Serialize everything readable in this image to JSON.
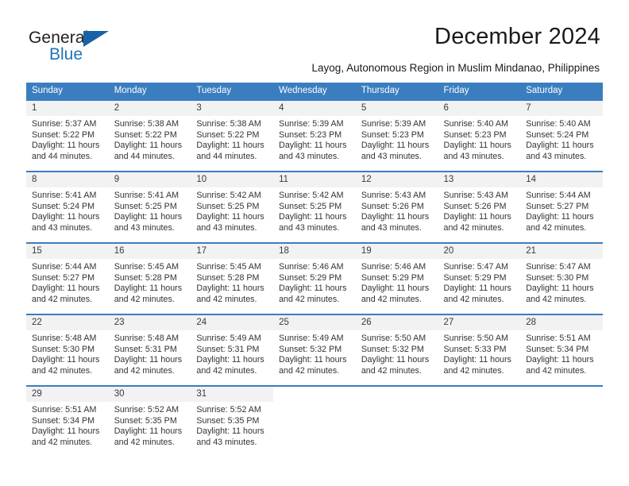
{
  "brand": {
    "name_top": "General",
    "name_bottom": "Blue",
    "accent_color": "#1763a5",
    "text_color": "#231f20"
  },
  "header": {
    "title": "December 2024",
    "subtitle": "Layog, Autonomous Region in Muslim Mindanao, Philippines"
  },
  "calendar": {
    "header_bg": "#3a7ebf",
    "header_text_color": "#ffffff",
    "daynum_bg": "#f2f2f2",
    "weekday_labels": [
      "Sunday",
      "Monday",
      "Tuesday",
      "Wednesday",
      "Thursday",
      "Friday",
      "Saturday"
    ],
    "labels": {
      "sunrise": "Sunrise:",
      "sunset": "Sunset:",
      "daylight": "Daylight:"
    },
    "weeks": [
      [
        {
          "day": "1",
          "sunrise": "Sunrise: 5:37 AM",
          "sunset": "Sunset: 5:22 PM",
          "daylight_line1": "Daylight: 11 hours",
          "daylight_line2": "and 44 minutes."
        },
        {
          "day": "2",
          "sunrise": "Sunrise: 5:38 AM",
          "sunset": "Sunset: 5:22 PM",
          "daylight_line1": "Daylight: 11 hours",
          "daylight_line2": "and 44 minutes."
        },
        {
          "day": "3",
          "sunrise": "Sunrise: 5:38 AM",
          "sunset": "Sunset: 5:22 PM",
          "daylight_line1": "Daylight: 11 hours",
          "daylight_line2": "and 44 minutes."
        },
        {
          "day": "4",
          "sunrise": "Sunrise: 5:39 AM",
          "sunset": "Sunset: 5:23 PM",
          "daylight_line1": "Daylight: 11 hours",
          "daylight_line2": "and 43 minutes."
        },
        {
          "day": "5",
          "sunrise": "Sunrise: 5:39 AM",
          "sunset": "Sunset: 5:23 PM",
          "daylight_line1": "Daylight: 11 hours",
          "daylight_line2": "and 43 minutes."
        },
        {
          "day": "6",
          "sunrise": "Sunrise: 5:40 AM",
          "sunset": "Sunset: 5:23 PM",
          "daylight_line1": "Daylight: 11 hours",
          "daylight_line2": "and 43 minutes."
        },
        {
          "day": "7",
          "sunrise": "Sunrise: 5:40 AM",
          "sunset": "Sunset: 5:24 PM",
          "daylight_line1": "Daylight: 11 hours",
          "daylight_line2": "and 43 minutes."
        }
      ],
      [
        {
          "day": "8",
          "sunrise": "Sunrise: 5:41 AM",
          "sunset": "Sunset: 5:24 PM",
          "daylight_line1": "Daylight: 11 hours",
          "daylight_line2": "and 43 minutes."
        },
        {
          "day": "9",
          "sunrise": "Sunrise: 5:41 AM",
          "sunset": "Sunset: 5:25 PM",
          "daylight_line1": "Daylight: 11 hours",
          "daylight_line2": "and 43 minutes."
        },
        {
          "day": "10",
          "sunrise": "Sunrise: 5:42 AM",
          "sunset": "Sunset: 5:25 PM",
          "daylight_line1": "Daylight: 11 hours",
          "daylight_line2": "and 43 minutes."
        },
        {
          "day": "11",
          "sunrise": "Sunrise: 5:42 AM",
          "sunset": "Sunset: 5:25 PM",
          "daylight_line1": "Daylight: 11 hours",
          "daylight_line2": "and 43 minutes."
        },
        {
          "day": "12",
          "sunrise": "Sunrise: 5:43 AM",
          "sunset": "Sunset: 5:26 PM",
          "daylight_line1": "Daylight: 11 hours",
          "daylight_line2": "and 43 minutes."
        },
        {
          "day": "13",
          "sunrise": "Sunrise: 5:43 AM",
          "sunset": "Sunset: 5:26 PM",
          "daylight_line1": "Daylight: 11 hours",
          "daylight_line2": "and 42 minutes."
        },
        {
          "day": "14",
          "sunrise": "Sunrise: 5:44 AM",
          "sunset": "Sunset: 5:27 PM",
          "daylight_line1": "Daylight: 11 hours",
          "daylight_line2": "and 42 minutes."
        }
      ],
      [
        {
          "day": "15",
          "sunrise": "Sunrise: 5:44 AM",
          "sunset": "Sunset: 5:27 PM",
          "daylight_line1": "Daylight: 11 hours",
          "daylight_line2": "and 42 minutes."
        },
        {
          "day": "16",
          "sunrise": "Sunrise: 5:45 AM",
          "sunset": "Sunset: 5:28 PM",
          "daylight_line1": "Daylight: 11 hours",
          "daylight_line2": "and 42 minutes."
        },
        {
          "day": "17",
          "sunrise": "Sunrise: 5:45 AM",
          "sunset": "Sunset: 5:28 PM",
          "daylight_line1": "Daylight: 11 hours",
          "daylight_line2": "and 42 minutes."
        },
        {
          "day": "18",
          "sunrise": "Sunrise: 5:46 AM",
          "sunset": "Sunset: 5:29 PM",
          "daylight_line1": "Daylight: 11 hours",
          "daylight_line2": "and 42 minutes."
        },
        {
          "day": "19",
          "sunrise": "Sunrise: 5:46 AM",
          "sunset": "Sunset: 5:29 PM",
          "daylight_line1": "Daylight: 11 hours",
          "daylight_line2": "and 42 minutes."
        },
        {
          "day": "20",
          "sunrise": "Sunrise: 5:47 AM",
          "sunset": "Sunset: 5:29 PM",
          "daylight_line1": "Daylight: 11 hours",
          "daylight_line2": "and 42 minutes."
        },
        {
          "day": "21",
          "sunrise": "Sunrise: 5:47 AM",
          "sunset": "Sunset: 5:30 PM",
          "daylight_line1": "Daylight: 11 hours",
          "daylight_line2": "and 42 minutes."
        }
      ],
      [
        {
          "day": "22",
          "sunrise": "Sunrise: 5:48 AM",
          "sunset": "Sunset: 5:30 PM",
          "daylight_line1": "Daylight: 11 hours",
          "daylight_line2": "and 42 minutes."
        },
        {
          "day": "23",
          "sunrise": "Sunrise: 5:48 AM",
          "sunset": "Sunset: 5:31 PM",
          "daylight_line1": "Daylight: 11 hours",
          "daylight_line2": "and 42 minutes."
        },
        {
          "day": "24",
          "sunrise": "Sunrise: 5:49 AM",
          "sunset": "Sunset: 5:31 PM",
          "daylight_line1": "Daylight: 11 hours",
          "daylight_line2": "and 42 minutes."
        },
        {
          "day": "25",
          "sunrise": "Sunrise: 5:49 AM",
          "sunset": "Sunset: 5:32 PM",
          "daylight_line1": "Daylight: 11 hours",
          "daylight_line2": "and 42 minutes."
        },
        {
          "day": "26",
          "sunrise": "Sunrise: 5:50 AM",
          "sunset": "Sunset: 5:32 PM",
          "daylight_line1": "Daylight: 11 hours",
          "daylight_line2": "and 42 minutes."
        },
        {
          "day": "27",
          "sunrise": "Sunrise: 5:50 AM",
          "sunset": "Sunset: 5:33 PM",
          "daylight_line1": "Daylight: 11 hours",
          "daylight_line2": "and 42 minutes."
        },
        {
          "day": "28",
          "sunrise": "Sunrise: 5:51 AM",
          "sunset": "Sunset: 5:34 PM",
          "daylight_line1": "Daylight: 11 hours",
          "daylight_line2": "and 42 minutes."
        }
      ],
      [
        {
          "day": "29",
          "sunrise": "Sunrise: 5:51 AM",
          "sunset": "Sunset: 5:34 PM",
          "daylight_line1": "Daylight: 11 hours",
          "daylight_line2": "and 42 minutes."
        },
        {
          "day": "30",
          "sunrise": "Sunrise: 5:52 AM",
          "sunset": "Sunset: 5:35 PM",
          "daylight_line1": "Daylight: 11 hours",
          "daylight_line2": "and 42 minutes."
        },
        {
          "day": "31",
          "sunrise": "Sunrise: 5:52 AM",
          "sunset": "Sunset: 5:35 PM",
          "daylight_line1": "Daylight: 11 hours",
          "daylight_line2": "and 43 minutes."
        },
        {
          "day": "",
          "sunrise": "",
          "sunset": "",
          "daylight_line1": "",
          "daylight_line2": ""
        },
        {
          "day": "",
          "sunrise": "",
          "sunset": "",
          "daylight_line1": "",
          "daylight_line2": ""
        },
        {
          "day": "",
          "sunrise": "",
          "sunset": "",
          "daylight_line1": "",
          "daylight_line2": ""
        },
        {
          "day": "",
          "sunrise": "",
          "sunset": "",
          "daylight_line1": "",
          "daylight_line2": ""
        }
      ]
    ]
  }
}
